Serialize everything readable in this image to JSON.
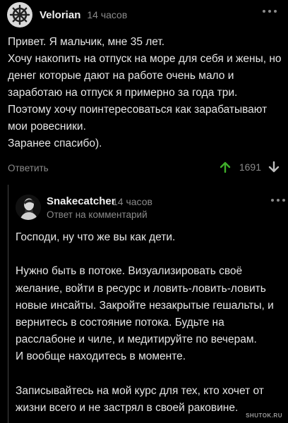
{
  "comment": {
    "username": "Velorian",
    "time": "14 часов",
    "avatar_icon": "ship-wheel-icon",
    "lines": [
      "Привет. Я мальчик, мне 35 лет.",
      "Хочу накопить на отпуск на море для себя и жены, но",
      "денег которые дают на работе очень мало и",
      "заработаю на отпуск я примерно за года три.",
      "Поэтому хочу поинтересоваться как зарабатывают",
      "мои ровесники.",
      "Заранее спасибо)."
    ],
    "reply_label": "Ответить",
    "rating": "1691",
    "upvote_color": "#3fae2a"
  },
  "reply": {
    "username": "Snakecatcher",
    "time": "14 часов",
    "subtitle": "Ответ на комментарий",
    "lines": [
      "Господи, ну что же вы как дети.",
      "",
      "Нужно быть в потоке. Визуализировать своё",
      "желание, войти в ресурс и ловить-ловить-ловить",
      "новые инсайты. Закройте незакрытые гешальты, и",
      "вернитесь в состояние потока. Будьте на",
      "расслабоне и чиле, и медитируйте по вечерам.",
      "И вообще находитесь в моменте.",
      "",
      "Записывайтесь на мой курс для тех, кто хочет от",
      "жизни всего и не застрял в своей раковине."
    ]
  },
  "watermark": "SHUTOK.RU"
}
